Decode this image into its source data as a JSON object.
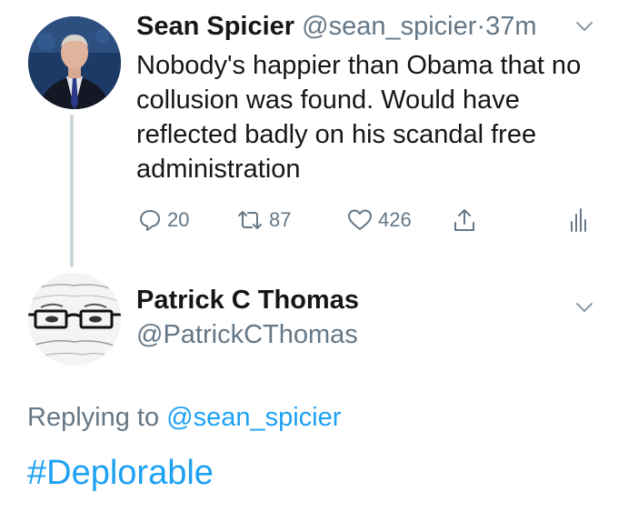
{
  "tweet": {
    "display_name": "Sean Spicier",
    "handle": "@sean_spicier",
    "separator": "·",
    "time": "37m",
    "text": "Nobody's happier than Obama that no collusion was found. Would have reflected badly on his scandal free administration",
    "actions": {
      "replies": "20",
      "retweets": "87",
      "likes": "426"
    },
    "icons": {
      "avatar": "spicer-avatar",
      "menu": "chevron-down-icon",
      "reply": "reply-icon",
      "retweet": "retweet-icon",
      "like": "heart-icon",
      "share": "share-icon",
      "analytics": "analytics-icon"
    }
  },
  "reply": {
    "display_name": "Patrick C Thomas",
    "handle": "@PatrickCThomas",
    "replying_prefix": "Replying to",
    "replying_to": "@sean_spicier",
    "text": "#Deplorable",
    "icons": {
      "avatar": "glasses-avatar",
      "menu": "chevron-down-icon"
    }
  },
  "colors": {
    "link": "#1da1f2",
    "muted": "#657786",
    "text": "#14171a",
    "thread_line": "#ccd6dd"
  }
}
